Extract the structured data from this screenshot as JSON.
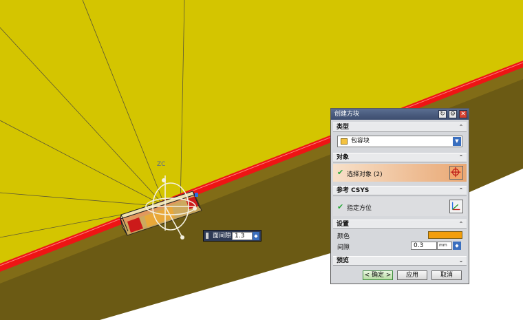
{
  "viewport": {
    "axis_label": "ZC",
    "colors": {
      "plane": "#d4c500",
      "edge_face": "#6b5a14",
      "rod": "#ee1414",
      "block": "#e0b970"
    }
  },
  "gap_popup": {
    "label": "面间隙",
    "value": "1.3"
  },
  "dialog": {
    "title": "创建方块",
    "title_buttons": [
      "reset-icon",
      "gear-icon",
      "close-icon"
    ],
    "type_section": {
      "label": "类型",
      "selected": "包容块"
    },
    "object_section": {
      "label": "对象",
      "item": "选择对象 (2)"
    },
    "csys_section": {
      "label": "参考 CSYS",
      "item": "指定方位"
    },
    "settings_section": {
      "label": "设置",
      "color_label": "颜色",
      "color_value": "#f29e0c",
      "gap_label": "间隙",
      "gap_value": "0.3",
      "gap_unit": "mm"
    },
    "preview_section": {
      "label": "预览"
    },
    "buttons": {
      "ok": "< 确定 >",
      "apply": "应用",
      "cancel": "取消"
    }
  }
}
